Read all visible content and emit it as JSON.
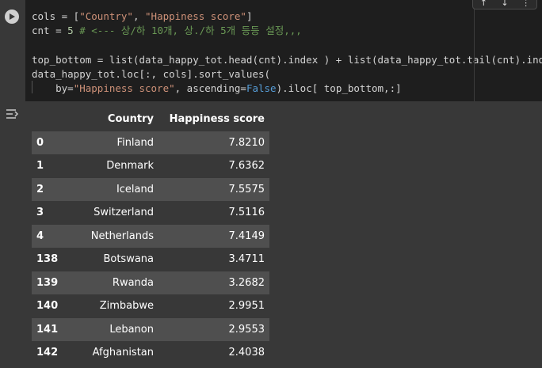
{
  "code_lines": [
    [
      {
        "t": "cols = [",
        "c": ""
      },
      {
        "t": "\"Country\"",
        "c": "str"
      },
      {
        "t": ", ",
        "c": ""
      },
      {
        "t": "\"Happiness score\"",
        "c": "str"
      },
      {
        "t": "]",
        "c": ""
      }
    ],
    [
      {
        "t": "cnt = ",
        "c": ""
      },
      {
        "t": "5",
        "c": "num"
      },
      {
        "t": " ",
        "c": ""
      },
      {
        "t": "# <--- 상/하 10개, 상./하 5개 등등 설정,,,",
        "c": "cmt"
      }
    ],
    [],
    [
      {
        "t": "top_bottom = list(data_happy_tot.head(cnt).index ) + list(data_happy_tot.tail(cnt).index )",
        "c": ""
      }
    ],
    [
      {
        "t": "data_happy_tot.loc[:, cols].sort_values(",
        "c": ""
      }
    ],
    [
      {
        "t": "    by=",
        "c": ""
      },
      {
        "t": "\"Happiness score\"",
        "c": "str"
      },
      {
        "t": ", ascending=",
        "c": ""
      },
      {
        "t": "False",
        "c": "kw"
      },
      {
        "t": ").iloc[ top_bottom,:]",
        "c": ""
      }
    ]
  ],
  "cell_toolbar": [
    "↑",
    "↓",
    "⋮"
  ],
  "table": {
    "columns": [
      "Country",
      "Happiness score"
    ],
    "rows": [
      {
        "index": "0",
        "country": "Finland",
        "score": "7.8210"
      },
      {
        "index": "1",
        "country": "Denmark",
        "score": "7.6362"
      },
      {
        "index": "2",
        "country": "Iceland",
        "score": "7.5575"
      },
      {
        "index": "3",
        "country": "Switzerland",
        "score": "7.5116"
      },
      {
        "index": "4",
        "country": "Netherlands",
        "score": "7.4149"
      },
      {
        "index": "138",
        "country": "Botswana",
        "score": "3.4711"
      },
      {
        "index": "139",
        "country": "Rwanda",
        "score": "3.2682"
      },
      {
        "index": "140",
        "country": "Zimbabwe",
        "score": "2.9951"
      },
      {
        "index": "141",
        "country": "Lebanon",
        "score": "2.9553"
      },
      {
        "index": "142",
        "country": "Afghanistan",
        "score": "2.4038"
      }
    ]
  },
  "icons": {
    "run": "play-icon",
    "output_toggle": "output-toggle-icon"
  },
  "colors": {
    "string": "#ce9178",
    "number": "#b5cea8",
    "comment": "#6a9955",
    "keyword": "#569cd6"
  }
}
